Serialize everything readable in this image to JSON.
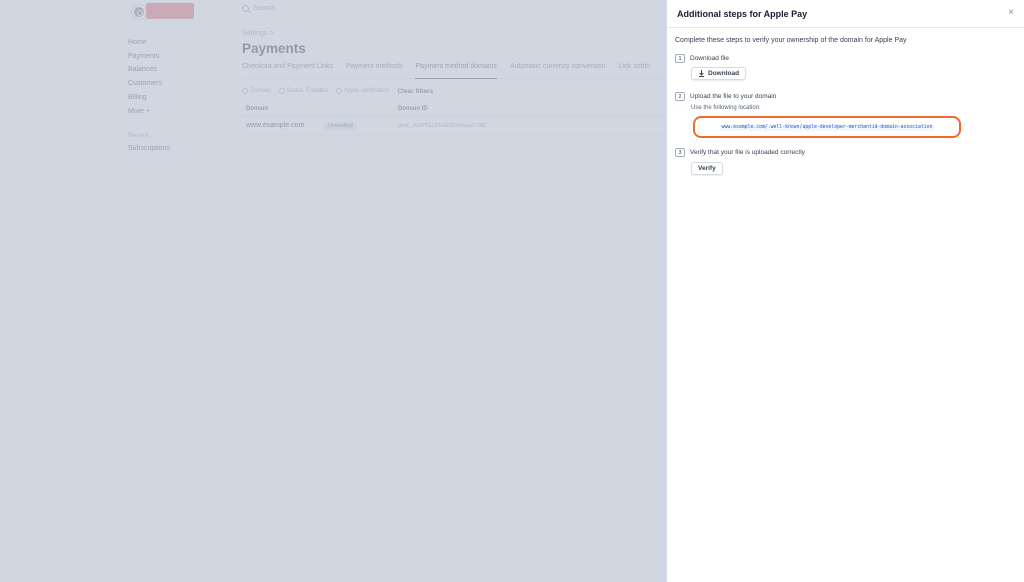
{
  "search": {
    "placeholder": "Search"
  },
  "sidebar": {
    "items": [
      {
        "label": "Home"
      },
      {
        "label": "Payments"
      },
      {
        "label": "Balances"
      },
      {
        "label": "Customers"
      },
      {
        "label": "Billing"
      },
      {
        "label": "More +"
      }
    ],
    "recent_label": "Recent",
    "recent_items": [
      {
        "label": "Subscriptions"
      }
    ]
  },
  "main": {
    "breadcrumb": "Settings >",
    "title": "Payments",
    "tabs": [
      {
        "label": "Checkout and Payment Links"
      },
      {
        "label": "Payment methods"
      },
      {
        "label": "Payment method domains"
      },
      {
        "label": "Automatic currency conversion"
      },
      {
        "label": "Link settin"
      }
    ],
    "filters": {
      "domain": "Domain",
      "status": "Status",
      "status_value": "Enabled",
      "apple_verification": "Apple verification",
      "clear": "Clear filters"
    },
    "table": {
      "headers": {
        "domain": "Domain",
        "domain_id": "Domain ID"
      },
      "rows": [
        {
          "domain": "www.example.com",
          "status": "Unverified",
          "domain_id": "pmd_1EcPTELBhGk5R9hlqsaC7AE"
        }
      ]
    }
  },
  "drawer": {
    "title": "Additional steps for Apple Pay",
    "intro": "Complete these steps to verify your ownership of the domain for Apple Pay",
    "steps": [
      {
        "num": "1",
        "label": "Download file",
        "button": "Download"
      },
      {
        "num": "2",
        "label": "Upload the file to your domain",
        "sub": "Use the following location:",
        "url": "www.example.com/.well-known/apple-developer-merchantid-domain-association"
      },
      {
        "num": "3",
        "label": "Verify that your file is uploaded correctly",
        "button": "Verify"
      }
    ]
  },
  "colors": {
    "highlight": "#f06a2c",
    "overlay": "#bfc8d6",
    "url_text": "#2d55c5"
  }
}
